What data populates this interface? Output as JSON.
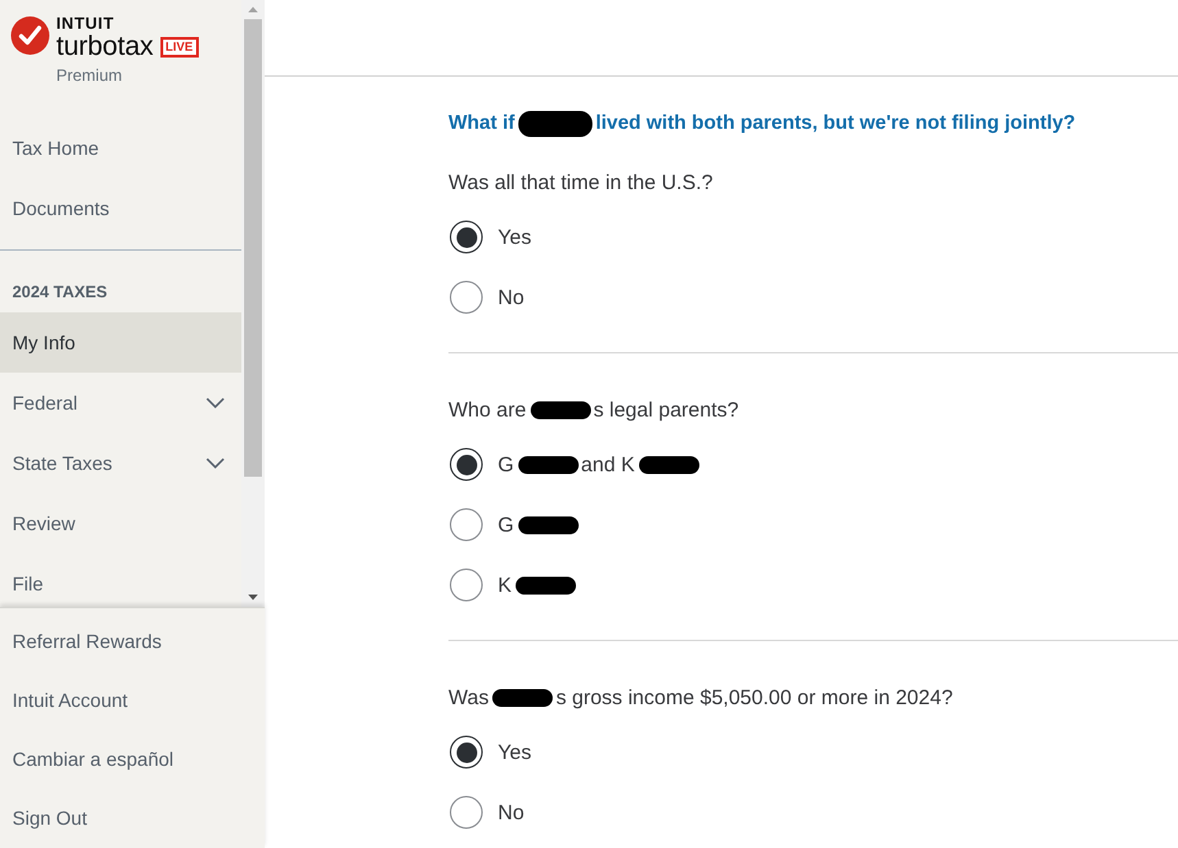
{
  "sidebar": {
    "logo": {
      "brand": "INTUIT",
      "product": "turbotax",
      "badge": "LIVE",
      "edition": "Premium"
    },
    "top_items": [
      {
        "label": "Tax Home",
        "selected": false
      },
      {
        "label": "Documents",
        "selected": false
      }
    ],
    "section": {
      "title": "2024 TAXES",
      "items": [
        {
          "label": "My Info",
          "kind": "link",
          "selected": true
        },
        {
          "label": "Federal",
          "kind": "expandable",
          "selected": false
        },
        {
          "label": "State Taxes",
          "kind": "expandable",
          "selected": false
        },
        {
          "label": "Review",
          "kind": "link",
          "selected": false
        },
        {
          "label": "File",
          "kind": "link",
          "selected": false
        }
      ]
    },
    "bottom_items": [
      {
        "label": "Referral Rewards",
        "selected": false
      },
      {
        "label": "Intuit Account",
        "selected": false
      },
      {
        "label": "Cambiar a español",
        "selected": false
      },
      {
        "label": "Sign Out",
        "selected": false
      }
    ]
  },
  "main": {
    "sections": [
      {
        "heading": [
          {
            "kind": "text",
            "text": "What if"
          },
          {
            "kind": "redaction"
          },
          {
            "kind": "text",
            "text": "lived with both parents, but we're not filing jointly?"
          }
        ],
        "prompt": [
          {
            "kind": "text",
            "text": "Was all that time in the U.S.?"
          }
        ],
        "options": [
          {
            "parts": [
              {
                "kind": "text",
                "text": "Yes"
              }
            ],
            "selected": true
          },
          {
            "parts": [
              {
                "kind": "text",
                "text": "No"
              }
            ],
            "selected": false
          }
        ]
      },
      {
        "prompt": [
          {
            "kind": "text",
            "text": "Who are"
          },
          {
            "kind": "redaction"
          },
          {
            "kind": "text",
            "text": "s legal parents?"
          }
        ],
        "options": [
          {
            "parts": [
              {
                "kind": "text",
                "text": "G"
              },
              {
                "kind": "redaction"
              },
              {
                "kind": "text",
                "text": "and K"
              },
              {
                "kind": "redaction"
              }
            ],
            "selected": true
          },
          {
            "parts": [
              {
                "kind": "text",
                "text": "G"
              },
              {
                "kind": "redaction"
              }
            ],
            "selected": false
          },
          {
            "parts": [
              {
                "kind": "text",
                "text": "K"
              },
              {
                "kind": "redaction"
              }
            ],
            "selected": false
          }
        ]
      },
      {
        "prompt": [
          {
            "kind": "text",
            "text": "Was"
          },
          {
            "kind": "redaction"
          },
          {
            "kind": "text",
            "text": "s gross income $5,050.00 or more in 2024?"
          }
        ],
        "options": [
          {
            "parts": [
              {
                "kind": "text",
                "text": "Yes"
              }
            ],
            "selected": true
          },
          {
            "parts": [
              {
                "kind": "text",
                "text": "No"
              }
            ],
            "selected": false
          }
        ]
      }
    ]
  }
}
